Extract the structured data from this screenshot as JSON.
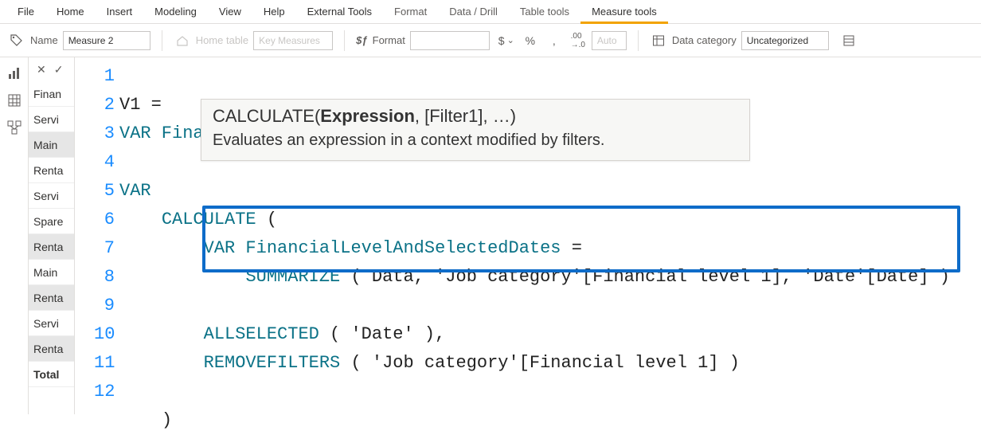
{
  "menubar": {
    "items": [
      "File",
      "Home",
      "Insert",
      "Modeling",
      "View",
      "Help",
      "External Tools",
      "Format",
      "Data / Drill",
      "Table tools",
      "Measure tools"
    ],
    "activeIndex": 10
  },
  "ribbon": {
    "name_label": "Name",
    "name_value": "Measure 2",
    "home_table_label": "Home table",
    "home_table_value": "Key Measures",
    "format_label": "Format",
    "format_value": "",
    "currency_symbol": "$",
    "percent_symbol": "%",
    "thousands_symbol": ",",
    "decimals_icon": ".00→.0",
    "auto_label": "Auto",
    "data_category_label": "Data category",
    "data_category_value": "Uncategorized",
    "fx_icon_label": "$ƒ"
  },
  "left_rail": {
    "icons": [
      "report",
      "data",
      "model"
    ]
  },
  "fx": {
    "cancel": "✕",
    "commit": "✓"
  },
  "fields": {
    "rows": [
      "Finan",
      "Servi",
      "Main",
      "Renta",
      "Servi",
      "Spare",
      "Renta",
      "Main",
      "Renta",
      "Servi",
      "Renta",
      "Total"
    ],
    "selectedIndexes": [
      2,
      6,
      8,
      10
    ]
  },
  "editor": {
    "lines": [
      "1",
      "2",
      "3",
      "4",
      "5",
      "6",
      "7",
      "8",
      "9",
      "10",
      "11",
      "12"
    ],
    "l1_lhs": "V1",
    "l1_eq": " =",
    "l2_var": "VAR",
    "l2_name": " FinancialLevelInFilterContext",
    "l2_eq": " =",
    "l4_var": "VAR",
    "l5_func": "CALCULATE",
    "l5_rest": " (",
    "l6_var": "VAR",
    "l6_name": " FinancialLevelAndSelectedDates",
    "l6_eq": " =",
    "l7_func": "SUMMARIZE",
    "l7_rest": " ( Data, 'Job category'[Financial level 1], 'Date'[Date] )",
    "l9_func": "ALLSELECTED",
    "l9_rest": " ( 'Date' ),",
    "l10_func": "REMOVEFILTERS",
    "l10_rest": " ( 'Job category'[Financial level 1] )",
    "l12_close": ")"
  },
  "tooltip": {
    "sig_pre": "CALCULATE(",
    "sig_bold": "Expression",
    "sig_post": ", [Filter1], …)",
    "desc": "Evaluates an expression in a context modified by filters."
  }
}
